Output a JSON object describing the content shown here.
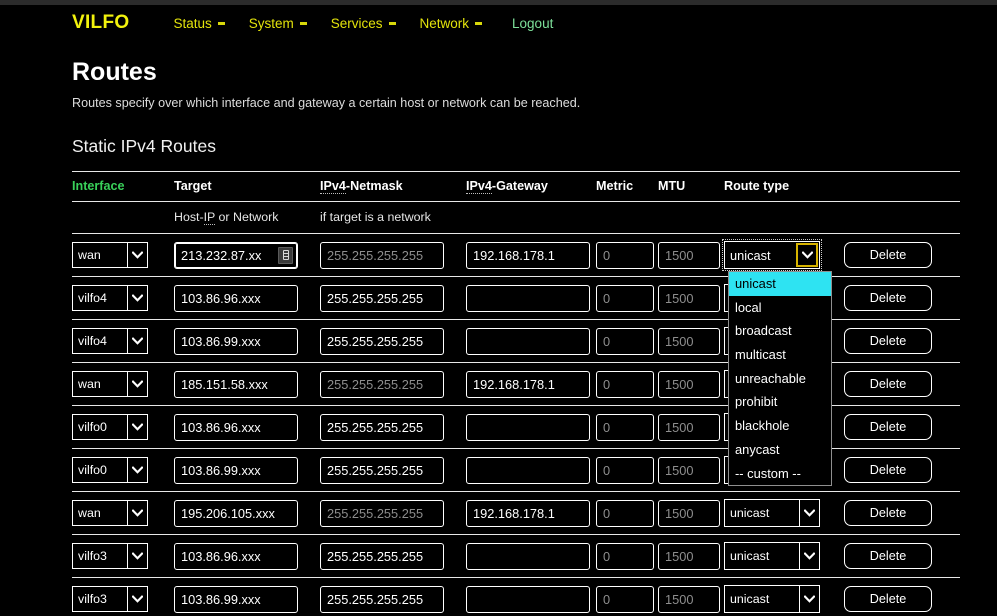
{
  "theme": {
    "background": "#000000",
    "chrome_strip": "#2b2b2b",
    "brand_color": "#f2f20d",
    "nav_color": "#e3e30b",
    "logout_color": "#7de09a",
    "active_header_color": "#39d05a",
    "dropdown_highlight": "#2ee3f2",
    "focus_ring": "#d7b400",
    "placeholder_color": "#8e8e8e"
  },
  "navbar": {
    "brand": "VILFO",
    "items": [
      {
        "label": "Status",
        "has_caret": true
      },
      {
        "label": "System",
        "has_caret": true
      },
      {
        "label": "Services",
        "has_caret": true
      },
      {
        "label": "Network",
        "has_caret": true
      }
    ],
    "logout": "Logout"
  },
  "page": {
    "title": "Routes",
    "description": "Routes specify over which interface and gateway a certain host or network can be reached.",
    "section_title": "Static IPv4 Routes"
  },
  "table": {
    "headers": [
      {
        "label": "Interface",
        "active": true,
        "abbr": null
      },
      {
        "label": "Target",
        "active": false,
        "abbr": null
      },
      {
        "label": "IPv4-Netmask",
        "active": false,
        "abbr": "IPv4"
      },
      {
        "label": "IPv4-Gateway",
        "active": false,
        "abbr": "IPv4"
      },
      {
        "label": "Metric",
        "active": false,
        "abbr": null
      },
      {
        "label": "MTU",
        "active": false,
        "abbr": null
      },
      {
        "label": "Route type",
        "active": false,
        "abbr": null
      },
      {
        "label": "",
        "active": false,
        "abbr": null
      }
    ],
    "hints": {
      "interface": "",
      "target": "Host-IP or Network",
      "target_abbr": "IP",
      "netmask": "if target is a network",
      "gateway": "",
      "metric": "",
      "mtu": "",
      "route_type": "",
      "actions": ""
    },
    "placeholders": {
      "netmask": "255.255.255.255",
      "metric": "0",
      "mtu": "1500",
      "gateway": "",
      "target": ""
    },
    "delete_label": "Delete",
    "rows": [
      {
        "interface": "wan",
        "target": "213.232.87.xx",
        "target_focused": true,
        "target_autofill_icon": "contact-card-icon",
        "netmask": "",
        "netmask_is_placeholder": true,
        "gateway": "192.168.178.1",
        "metric": "",
        "mtu": "",
        "route_type": "unicast",
        "route_type_open": true
      },
      {
        "interface": "vilfo4",
        "target": "103.86.96.xxx",
        "target_focused": false,
        "netmask": "255.255.255.255",
        "netmask_is_placeholder": false,
        "gateway": "",
        "metric": "",
        "mtu": "",
        "route_type": "unicast",
        "route_type_open": false
      },
      {
        "interface": "vilfo4",
        "target": "103.86.99.xxx",
        "target_focused": false,
        "netmask": "255.255.255.255",
        "netmask_is_placeholder": false,
        "gateway": "",
        "metric": "",
        "mtu": "",
        "route_type": "unicast",
        "route_type_open": false
      },
      {
        "interface": "wan",
        "target": "185.151.58.xxx",
        "target_focused": false,
        "netmask": "",
        "netmask_is_placeholder": true,
        "gateway": "192.168.178.1",
        "metric": "",
        "mtu": "",
        "route_type": "unicast",
        "route_type_open": false
      },
      {
        "interface": "vilfo0",
        "target": "103.86.96.xxx",
        "target_focused": false,
        "netmask": "255.255.255.255",
        "netmask_is_placeholder": false,
        "gateway": "",
        "metric": "",
        "mtu": "",
        "route_type": "unicast",
        "route_type_open": false
      },
      {
        "interface": "vilfo0",
        "target": "103.86.99.xxx",
        "target_focused": false,
        "netmask": "255.255.255.255",
        "netmask_is_placeholder": false,
        "gateway": "",
        "metric": "",
        "mtu": "",
        "route_type": "unicast",
        "route_type_open": false
      },
      {
        "interface": "wan",
        "target": "195.206.105.xxx",
        "target_focused": false,
        "netmask": "",
        "netmask_is_placeholder": true,
        "gateway": "192.168.178.1",
        "metric": "",
        "mtu": "",
        "route_type": "unicast",
        "route_type_open": false
      },
      {
        "interface": "vilfo3",
        "target": "103.86.96.xxx",
        "target_focused": false,
        "netmask": "255.255.255.255",
        "netmask_is_placeholder": false,
        "gateway": "",
        "metric": "",
        "mtu": "",
        "route_type": "unicast",
        "route_type_open": false
      },
      {
        "interface": "vilfo3",
        "target": "103.86.99.xxx",
        "target_focused": false,
        "netmask": "255.255.255.255",
        "netmask_is_placeholder": false,
        "gateway": "",
        "metric": "",
        "mtu": "",
        "route_type": "unicast",
        "route_type_open": false
      }
    ]
  },
  "route_type_dropdown": {
    "open": true,
    "selected": "unicast",
    "options": [
      "unicast",
      "local",
      "broadcast",
      "multicast",
      "unreachable",
      "prohibit",
      "blackhole",
      "anycast",
      "-- custom --"
    ]
  }
}
